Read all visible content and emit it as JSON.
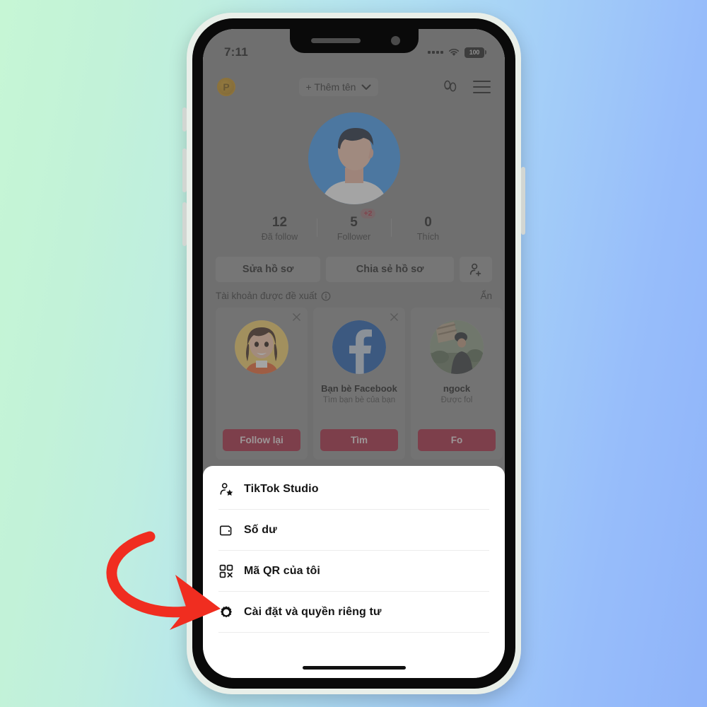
{
  "background": {
    "from": "#c6f6d5",
    "to": "#8fb3f9"
  },
  "status_bar": {
    "time": "7:11",
    "battery": "100",
    "signal_icon": "signal-dots-icon",
    "wifi_icon": "wifi-icon",
    "battery_icon": "battery-icon"
  },
  "app_header": {
    "badge_label": "P",
    "badge_icon": "pro-badge-icon",
    "add_name_label": "+ Thêm tên",
    "chevron_icon": "chevron-down-icon",
    "friends_icon": "footprints-friends-icon",
    "menu_icon": "hamburger-menu-icon"
  },
  "profile": {
    "avatar_icon": "user-avatar",
    "avatar_bg": "#3d9bf7",
    "stats": [
      {
        "num": "12",
        "label": "Đã follow",
        "badge": ""
      },
      {
        "num": "5",
        "label": "Follower",
        "badge": "+2"
      },
      {
        "num": "0",
        "label": "Thích",
        "badge": ""
      }
    ],
    "actions": {
      "edit_label": "Sửa hồ sơ",
      "share_label": "Chia sẻ hồ sơ",
      "add_friend_icon": "add-person-icon"
    }
  },
  "suggested": {
    "title": "Tài khoản được đề xuất",
    "info_icon": "info-circle-icon",
    "hide_label": "Ẩn",
    "close_icon": "close-x-icon",
    "cards": [
      {
        "name": "",
        "sub": "",
        "button": "Follow lại",
        "avatar": "girl-avatar"
      },
      {
        "name": "Bạn bè Facebook",
        "sub": "Tìm bạn bè của bạn",
        "button": "Tìm",
        "avatar": "facebook-logo"
      },
      {
        "name": "ngock",
        "sub": "Được fol",
        "button": "Fo",
        "avatar": "photo-avatar"
      }
    ],
    "button_color": "#a8213b"
  },
  "sheet": {
    "items": [
      {
        "label": "TikTok Studio",
        "icon": "person-star-icon"
      },
      {
        "label": "Số dư",
        "icon": "wallet-icon"
      },
      {
        "label": "Mã QR của tôi",
        "icon": "qr-code-icon"
      },
      {
        "label": "Cài đặt và quyền riêng tư",
        "icon": "gear-settings-icon"
      }
    ]
  },
  "annotation": {
    "arrow_icon": "red-curved-arrow",
    "arrow_color": "#f02d20",
    "points_to": "Cài đặt và quyền riêng tư"
  }
}
